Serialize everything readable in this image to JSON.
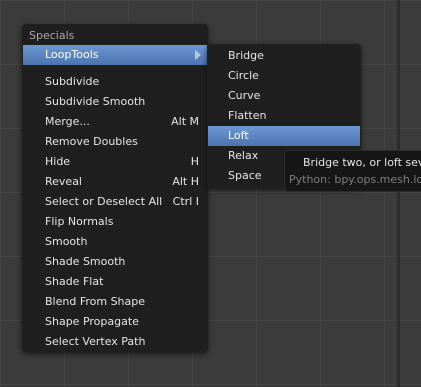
{
  "specials_menu": {
    "title": "Specials",
    "items": [
      {
        "label": "LoopTools",
        "shortcut": "",
        "has_submenu": true,
        "active": true
      },
      {
        "label": "Subdivide",
        "shortcut": ""
      },
      {
        "label": "Subdivide Smooth",
        "shortcut": ""
      },
      {
        "label": "Merge...",
        "shortcut": "Alt M"
      },
      {
        "label": "Remove Doubles",
        "shortcut": ""
      },
      {
        "label": "Hide",
        "shortcut": "H"
      },
      {
        "label": "Reveal",
        "shortcut": "Alt H"
      },
      {
        "label": "Select or Deselect All",
        "shortcut": "Ctrl I"
      },
      {
        "label": "Flip Normals",
        "shortcut": ""
      },
      {
        "label": "Smooth",
        "shortcut": ""
      },
      {
        "label": "Shade Smooth",
        "shortcut": ""
      },
      {
        "label": "Shade Flat",
        "shortcut": ""
      },
      {
        "label": "Blend From Shape",
        "shortcut": ""
      },
      {
        "label": "Shape Propagate",
        "shortcut": ""
      },
      {
        "label": "Select Vertex Path",
        "shortcut": ""
      }
    ]
  },
  "looptools_menu": {
    "items": [
      {
        "label": "Bridge"
      },
      {
        "label": "Circle"
      },
      {
        "label": "Curve"
      },
      {
        "label": "Flatten"
      },
      {
        "label": "Loft",
        "active": true
      },
      {
        "label": "Relax"
      },
      {
        "label": "Space"
      }
    ]
  },
  "tooltip": {
    "description": "Bridge two, or loft sever",
    "python": "Python: bpy.ops.mesh.loop"
  },
  "colors": {
    "menu_bg": "#1f1f1f",
    "highlight": "#5a86c4",
    "viewport_bg": "#3b3b3b"
  }
}
